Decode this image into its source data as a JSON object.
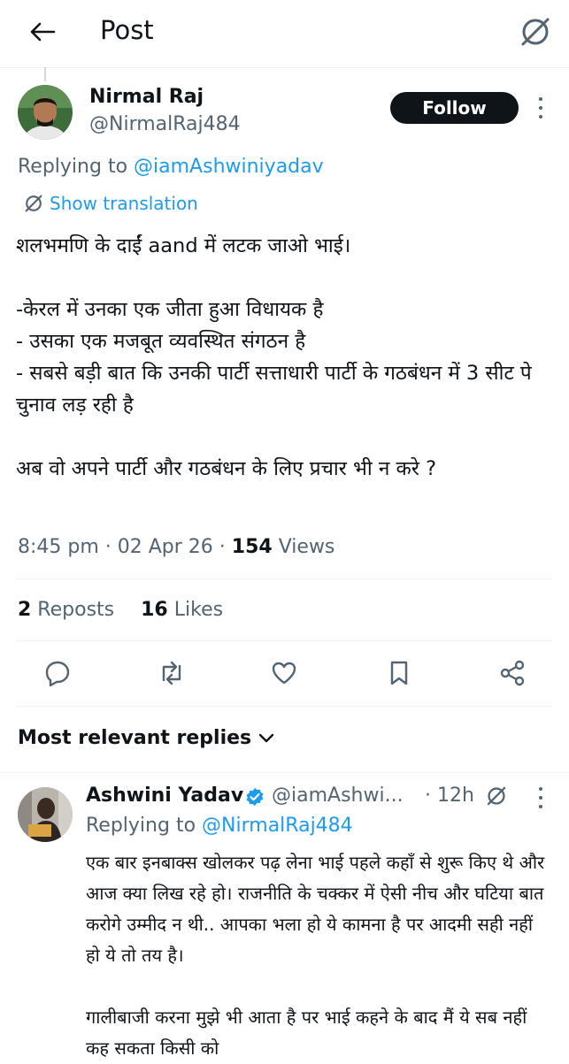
{
  "header": {
    "title": "Post"
  },
  "post": {
    "author_name": "Nirmal Raj",
    "author_handle": "@NirmalRaj484",
    "follow_label": "Follow",
    "replying_prefix": "Replying to ",
    "replying_to": "@iamAshwiniyadav",
    "show_translation": "Show translation",
    "body": "शलभमणि के दाईं aand में लटक जाओ भाई।\n\n-केरल में उनका एक जीता हुआ विधायक है\n- उसका एक मजबूत व्यवस्थित संगठन है\n- सबसे बड़ी बात कि उनकी पार्टी सत्ताधारी पार्टी के गठबंधन में 3 सीट पे चुनाव लड़ रही है\n\nअब वो अपने पार्टी और गठबंधन के लिए प्रचार भी न करे ?",
    "time": "8:45 pm · 02 Apr 26 · ",
    "views_count": "154",
    "views_label": " Views",
    "reposts_count": "2",
    "reposts_label": " Reposts",
    "likes_count": "16",
    "likes_label": " Likes"
  },
  "replies_sort": {
    "label": "Most relevant replies"
  },
  "reply": {
    "author_name": "Ashwini Yadav",
    "author_handle": "@iamAshwi...",
    "time": "· 12h",
    "replying_prefix": "Replying to ",
    "replying_to": "@NirmalRaj484",
    "body": "एक बार इनबाक्स खोलकर पढ़ लेना भाई पहले कहाँ से शुरू किए थे और आज क्या लिख रहे हो। राजनीति के चक्कर में ऐसी नीच और घटिया बात करोगे उम्मीद न थी.. आपका भला हो ये कामना है पर आदमी सही नहीं हो ये तो तय है।\n\nगालीबाजी करना मुझे भी आता है पर भाई कहने के बाद मैं ये सब नहीं कह सकता किसी को"
  },
  "colors": {
    "accent": "#1d9bf0",
    "text": "#0f1419",
    "muted": "#536471",
    "verified": "#1d9bf0"
  }
}
